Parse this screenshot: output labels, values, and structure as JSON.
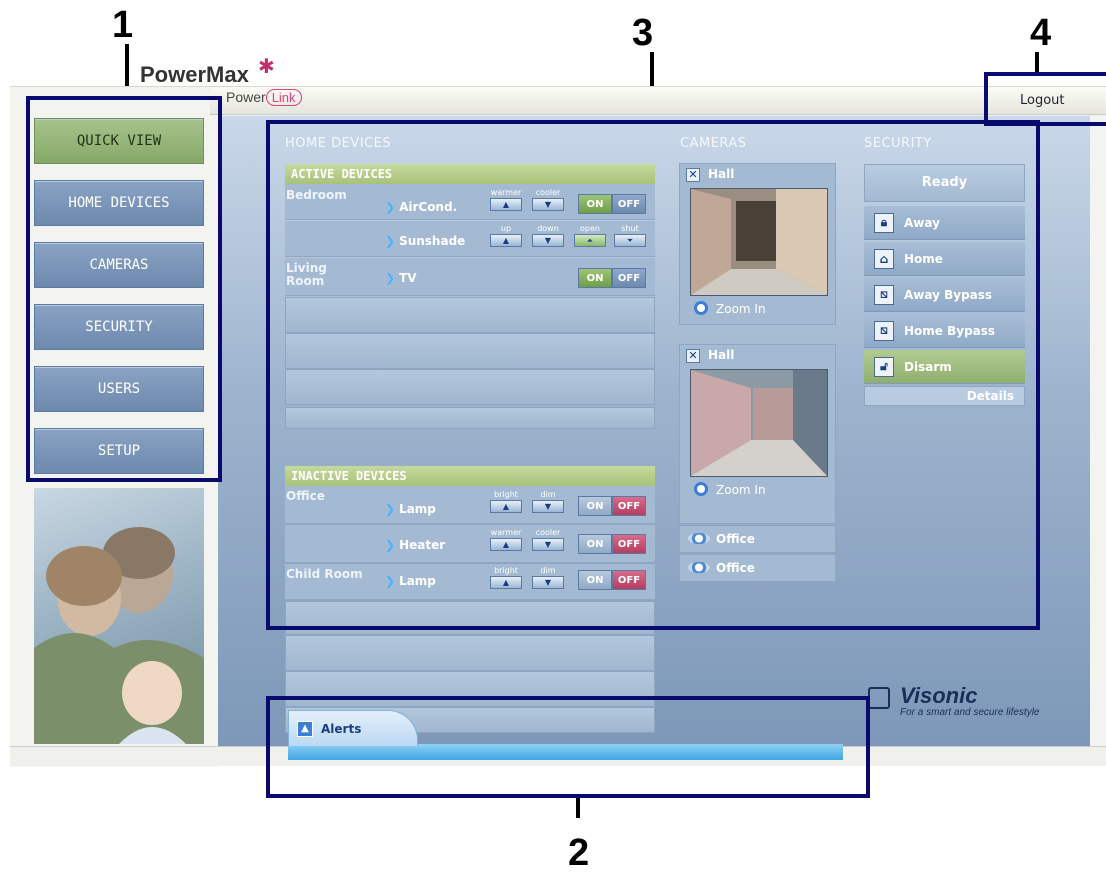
{
  "callouts": [
    "1",
    "2",
    "3",
    "4"
  ],
  "brand": {
    "top": "PowerMax",
    "sub_left": "Power",
    "sub_right": "Link"
  },
  "header": {
    "logout_label": "Logout"
  },
  "nav": {
    "items": [
      {
        "label": "QUICK VIEW",
        "active": true
      },
      {
        "label": "HOME DEVICES",
        "active": false
      },
      {
        "label": "CAMERAS",
        "active": false
      },
      {
        "label": "SECURITY",
        "active": false
      },
      {
        "label": "USERS",
        "active": false
      },
      {
        "label": "SETUP",
        "active": false
      }
    ]
  },
  "home_devices": {
    "title": "HOME DEVICES",
    "active_title": "ACTIVE DEVICES",
    "inactive_title": "INACTIVE DEVICES",
    "active": [
      {
        "room": "Bedroom",
        "device": "AirCond.",
        "controls": [
          "warmer",
          "cooler"
        ],
        "state": "on"
      },
      {
        "room": "",
        "device": "Sunshade",
        "controls": [
          "up",
          "down",
          "open",
          "shut"
        ],
        "state": ""
      },
      {
        "room": "Living Room",
        "device": "TV",
        "controls": [],
        "state": "on"
      }
    ],
    "inactive": [
      {
        "room": "Office",
        "device": "Lamp",
        "controls": [
          "bright",
          "dim"
        ],
        "state": "off"
      },
      {
        "room": "",
        "device": "Heater",
        "controls": [
          "warmer",
          "cooler"
        ],
        "state": "off"
      },
      {
        "room": "Child Room",
        "device": "Lamp",
        "controls": [
          "bright",
          "dim"
        ],
        "state": "off"
      }
    ],
    "on_label": "ON",
    "off_label": "OFF"
  },
  "cameras": {
    "title": "CAMERAS",
    "items": [
      {
        "name": "Hall",
        "zoom_label": "Zoom In"
      },
      {
        "name": "Hall",
        "zoom_label": "Zoom In"
      }
    ],
    "others": [
      "Office",
      "Office"
    ]
  },
  "security": {
    "title": "SECURITY",
    "status": "Ready",
    "buttons": [
      {
        "label": "Away",
        "icon": "lock-icon",
        "active": false
      },
      {
        "label": "Home",
        "icon": "home-icon",
        "active": false
      },
      {
        "label": "Away Bypass",
        "icon": "bypass-icon",
        "active": false
      },
      {
        "label": "Home Bypass",
        "icon": "bypass-icon",
        "active": false
      },
      {
        "label": "Disarm",
        "icon": "unlock-icon",
        "active": true
      }
    ],
    "details_label": "Details"
  },
  "footer": {
    "brand": "Visonic",
    "tagline": "For a smart and secure lifestyle"
  },
  "alerts": {
    "label": "Alerts"
  },
  "colors": {
    "highlight": "#0a0a6e",
    "active_green": "#86a76a",
    "off_red": "#b53d60"
  }
}
